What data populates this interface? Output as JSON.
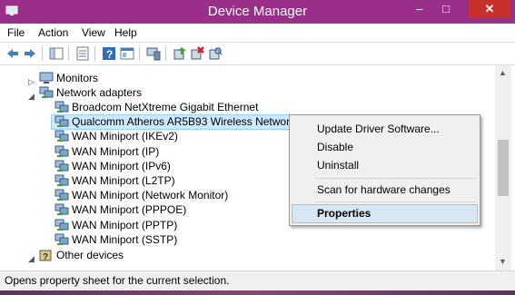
{
  "title": "Device Manager",
  "window_buttons": {
    "minimize": "–",
    "maximize": "□",
    "close": "✕"
  },
  "menu": [
    "File",
    "Action",
    "View",
    "Help"
  ],
  "toolbar": [
    "back-icon",
    "forward-icon",
    "show-hide-tree-icon",
    "properties-icon",
    "help-icon",
    "view-icon",
    "monitor-icon",
    "update-driver-icon",
    "uninstall-icon",
    "scan-hardware-icon"
  ],
  "tree": {
    "monitors": "Monitors",
    "network_adapters": "Network adapters",
    "adapters": [
      "Broadcom NetXtreme Gigabit Ethernet",
      "Qualcomm Atheros AR5B93 Wireless Network Ada",
      "WAN Miniport (IKEv2)",
      "WAN Miniport (IP)",
      "WAN Miniport (IPv6)",
      "WAN Miniport (L2TP)",
      "WAN Miniport (Network Monitor)",
      "WAN Miniport (PPPOE)",
      "WAN Miniport (PPTP)",
      "WAN Miniport (SSTP)"
    ],
    "other_devices": "Other devices"
  },
  "context_menu": {
    "update_driver": "Update Driver Software...",
    "disable": "Disable",
    "uninstall": "Uninstall",
    "scan": "Scan for hardware changes",
    "properties": "Properties"
  },
  "status": "Opens property sheet for the current selection.",
  "colors": {
    "titlebar": "#9a2f89",
    "close": "#c7302b",
    "selection": "#cde8ff"
  }
}
